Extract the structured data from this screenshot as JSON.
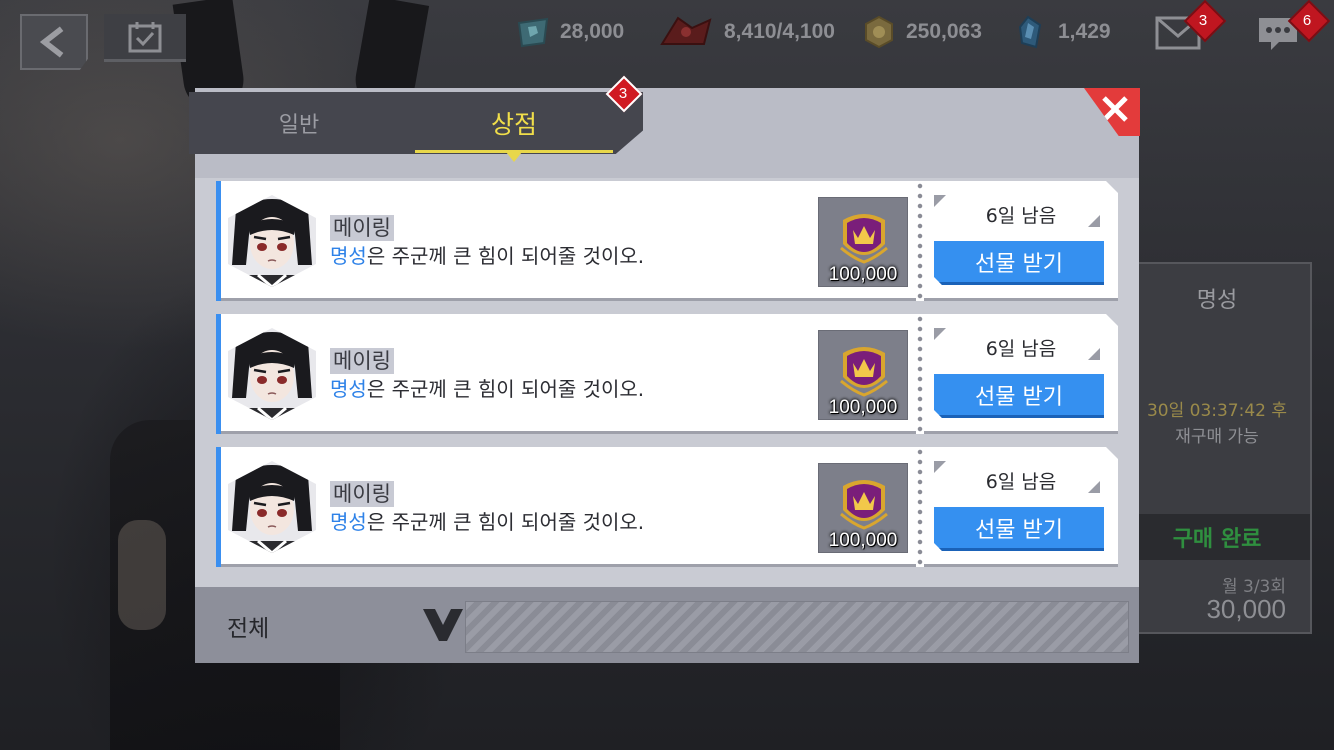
{
  "topbar": {
    "resources": [
      {
        "icon": "gem-card-icon",
        "value": "28,000"
      },
      {
        "icon": "flag-icon",
        "value": "8,410/4,100"
      },
      {
        "icon": "gold-coin-icon",
        "value": "250,063"
      },
      {
        "icon": "crystal-icon",
        "value": "1,429"
      }
    ],
    "mail_badge": "3",
    "chat_badge": "6"
  },
  "modal": {
    "tabs": [
      {
        "label": "일반"
      },
      {
        "label": "상점"
      }
    ],
    "active_tab": 1,
    "shop_badge": "3",
    "items": [
      {
        "name": "메이링",
        "desc_highlight": "명성",
        "desc_rest": "은 주군께 큰 힘이 되어줄 것이오.",
        "reward_amount": "100,000",
        "remaining": "6일 남음",
        "claim_label": "선물 받기"
      },
      {
        "name": "메이링",
        "desc_highlight": "명성",
        "desc_rest": "은 주군께 큰 힘이 되어줄 것이오.",
        "reward_amount": "100,000",
        "remaining": "6일 남음",
        "claim_label": "선물 받기"
      },
      {
        "name": "메이링",
        "desc_highlight": "명성",
        "desc_rest": "은 주군께 큰 힘이 되어줄 것이오.",
        "reward_amount": "100,000",
        "remaining": "6일 남음",
        "claim_label": "선물 받기"
      }
    ],
    "footer": {
      "filter_label": "전체"
    }
  },
  "background_shop": {
    "title": "명성",
    "timer": "30일 03:37:42 후",
    "rebuy": "재구매 가능",
    "status": "구매 완료",
    "limit": "월 3/3회",
    "price": "30,000"
  },
  "colors": {
    "accent_blue": "#3590f0",
    "tab_active": "#f0de4a",
    "close_red": "#e33b3b",
    "badge_red": "#c01620",
    "completed_green": "#2f8f3f"
  }
}
